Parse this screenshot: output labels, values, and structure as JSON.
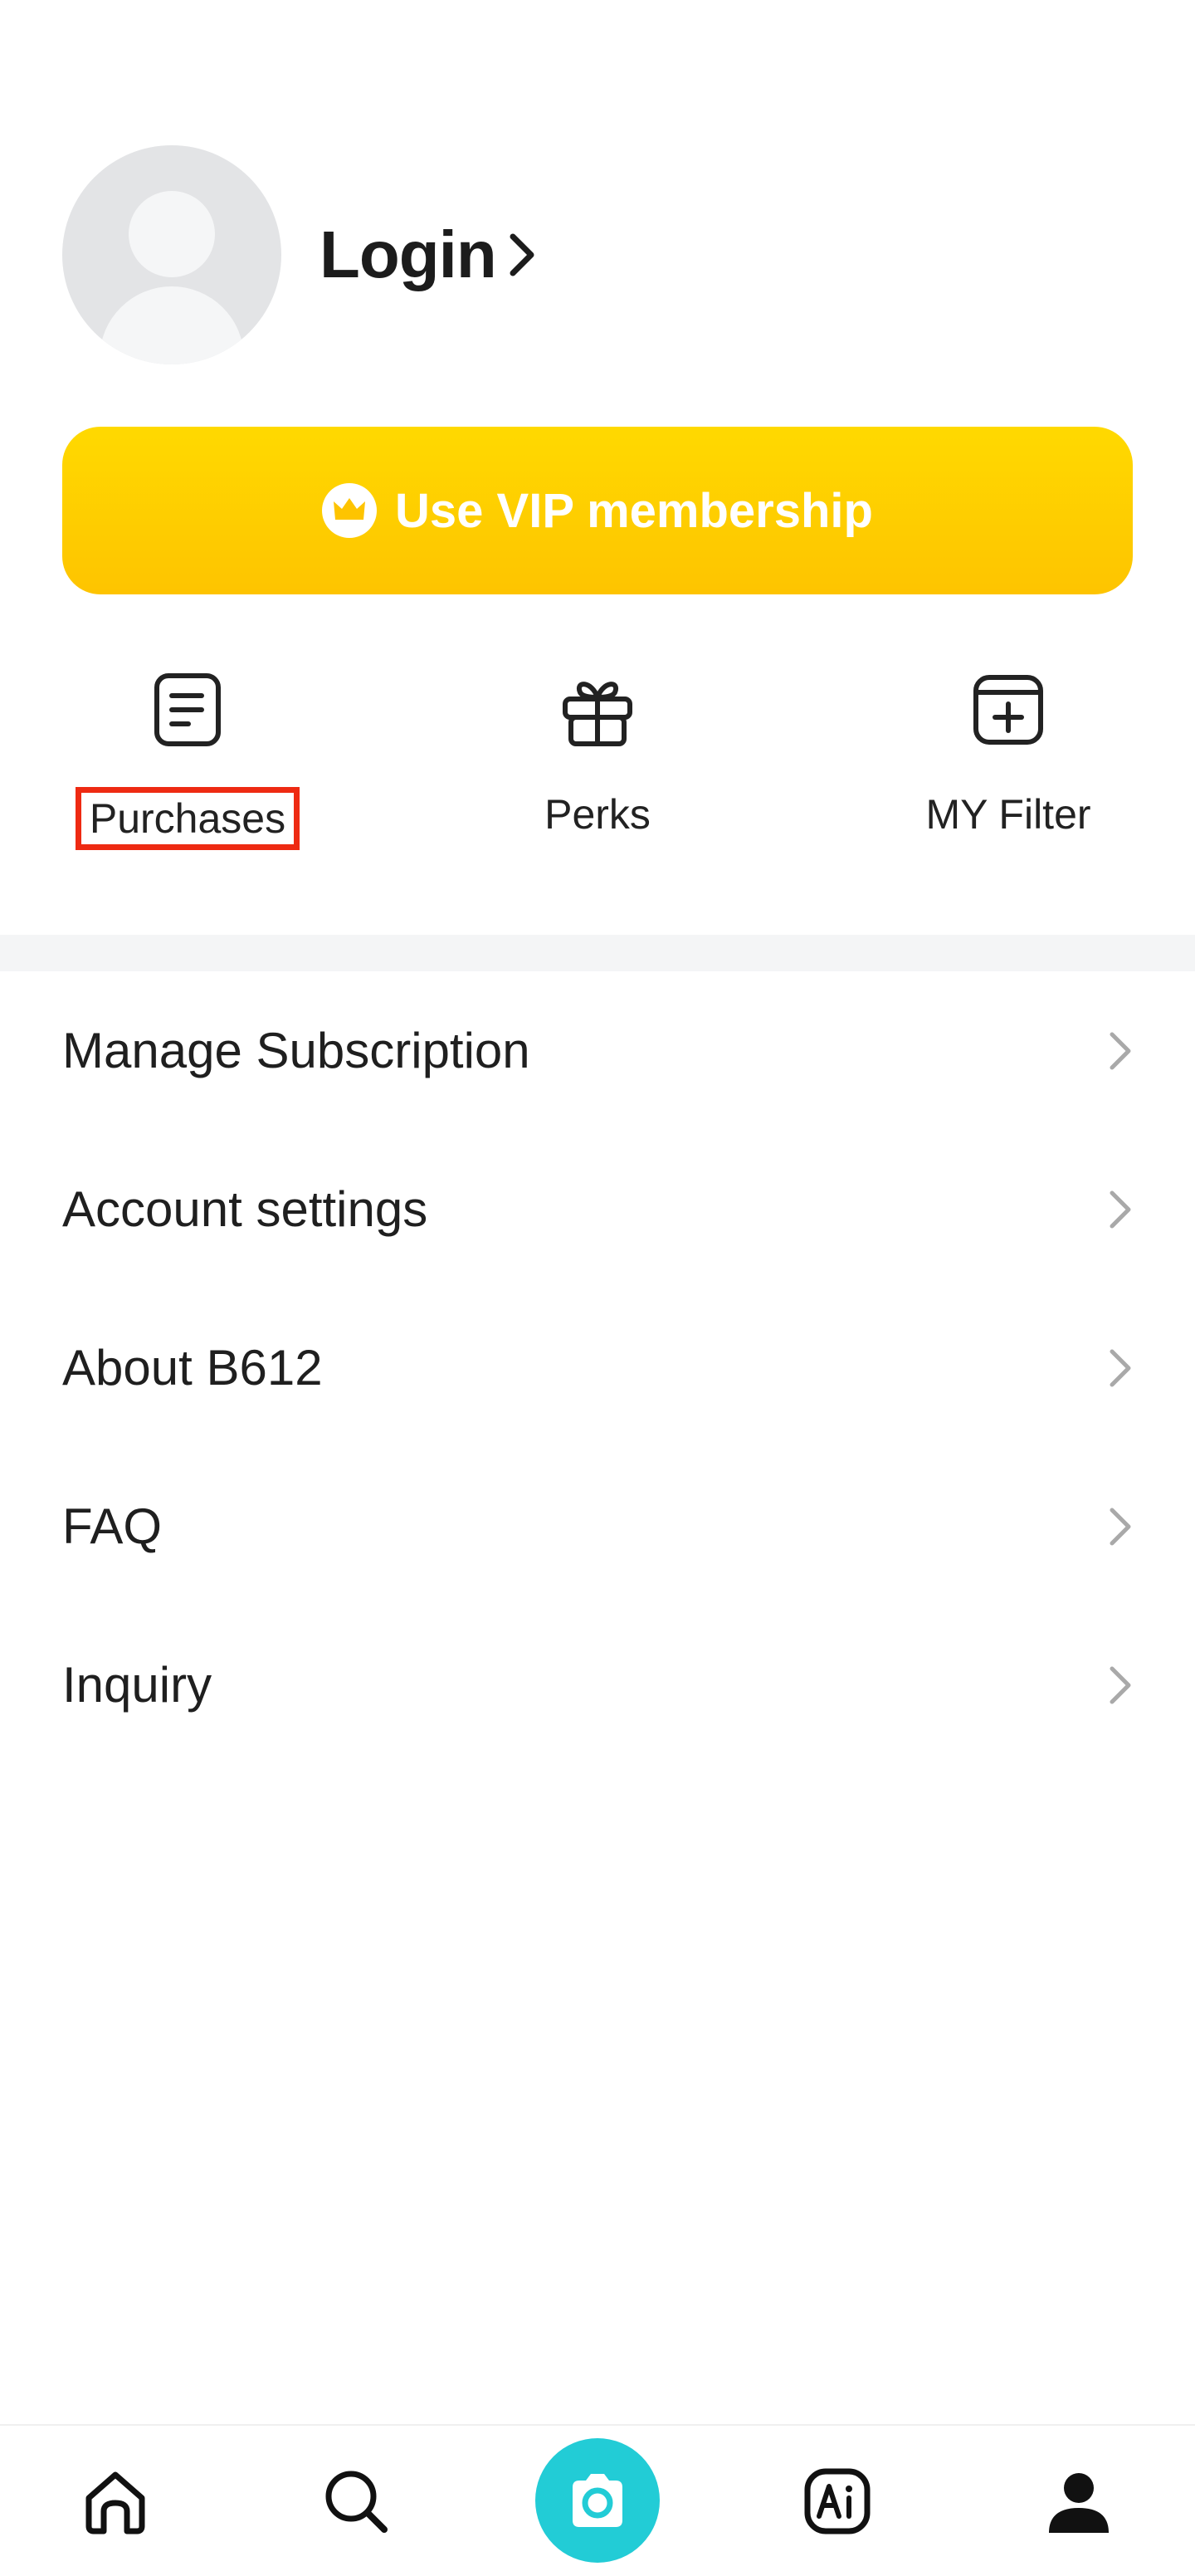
{
  "profile": {
    "login_label": "Login"
  },
  "vip": {
    "label": "Use VIP membership"
  },
  "quick_actions": [
    {
      "label": "Purchases",
      "icon": "document-icon"
    },
    {
      "label": "Perks",
      "icon": "gift-icon"
    },
    {
      "label": "MY Filter",
      "icon": "add-filter-icon"
    }
  ],
  "menu": [
    {
      "label": "Manage Subscription"
    },
    {
      "label": "Account settings"
    },
    {
      "label": "About B612"
    },
    {
      "label": "FAQ"
    },
    {
      "label": "Inquiry"
    }
  ],
  "tabbar": {
    "tabs": [
      "home-icon",
      "search-icon",
      "camera-icon",
      "ai-icon",
      "profile-icon"
    ],
    "active": "profile-icon"
  },
  "colors": {
    "vip_gradient_top": "#ffd900",
    "vip_gradient_bottom": "#fec400",
    "camera_accent": "#22ccd6",
    "highlight_box": "#ee2a12"
  }
}
